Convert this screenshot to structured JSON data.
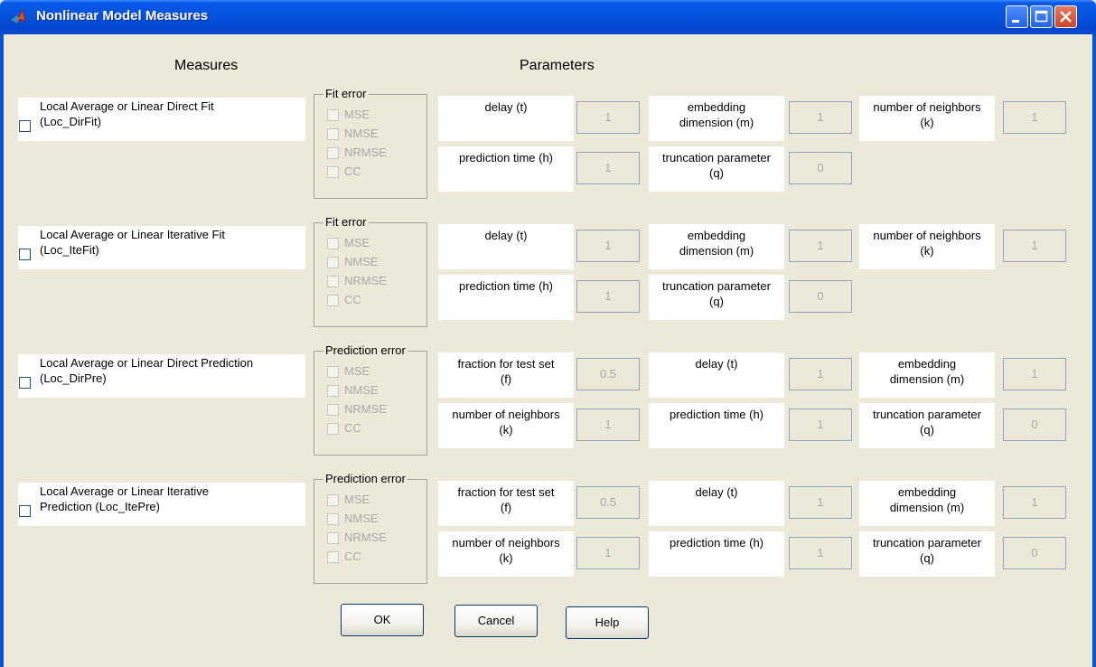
{
  "window": {
    "title": "Nonlinear Model Measures"
  },
  "headers": {
    "measures": "Measures",
    "parameters": "Parameters"
  },
  "error_items": [
    "MSE",
    "NMSE",
    "NRMSE",
    "CC"
  ],
  "rows": [
    {
      "measure_line1": "Local Average or Linear Direct Fit",
      "measure_line2": "(Loc_DirFit)",
      "group_title": "Fit error",
      "params": [
        {
          "line1": "delay (t)",
          "line2": "",
          "value": "1"
        },
        {
          "line1": "embedding",
          "line2": "dimension (m)",
          "value": "1"
        },
        {
          "line1": "number of neighbors",
          "line2": "(k)",
          "value": "1"
        },
        {
          "line1": "prediction time (h)",
          "line2": "",
          "value": "1"
        },
        {
          "line1": "truncation parameter",
          "line2": "(q)",
          "value": "0"
        }
      ]
    },
    {
      "measure_line1": "Local Average or Linear Iterative Fit",
      "measure_line2": "(Loc_IteFit)",
      "group_title": "Fit error",
      "params": [
        {
          "line1": "delay (t)",
          "line2": "",
          "value": "1"
        },
        {
          "line1": "embedding",
          "line2": "dimension (m)",
          "value": "1"
        },
        {
          "line1": "number of neighbors",
          "line2": "(k)",
          "value": "1"
        },
        {
          "line1": "prediction time (h)",
          "line2": "",
          "value": "1"
        },
        {
          "line1": "truncation parameter",
          "line2": "(q)",
          "value": "0"
        }
      ]
    },
    {
      "measure_line1": "Local Average or Linear Direct Prediction",
      "measure_line2": "(Loc_DirPre)",
      "group_title": "Prediction error",
      "params": [
        {
          "line1": "fraction for test set",
          "line2": "(f)",
          "value": "0.5"
        },
        {
          "line1": "delay (t)",
          "line2": "",
          "value": "1"
        },
        {
          "line1": "embedding",
          "line2": "dimension (m)",
          "value": "1"
        },
        {
          "line1": "number of neighbors",
          "line2": "(k)",
          "value": "1"
        },
        {
          "line1": "prediction time (h)",
          "line2": "",
          "value": "1"
        },
        {
          "line1": "truncation parameter",
          "line2": "(q)",
          "value": "0"
        }
      ]
    },
    {
      "measure_line1": "Local Average or Linear Iterative",
      "measure_line2": "Prediction (Loc_ItePre)",
      "group_title": "Prediction error",
      "params": [
        {
          "line1": "fraction for test set",
          "line2": "(f)",
          "value": "0.5"
        },
        {
          "line1": "delay (t)",
          "line2": "",
          "value": "1"
        },
        {
          "line1": "embedding",
          "line2": "dimension (m)",
          "value": "1"
        },
        {
          "line1": "number of neighbors",
          "line2": "(k)",
          "value": "1"
        },
        {
          "line1": "prediction time (h)",
          "line2": "",
          "value": "1"
        },
        {
          "line1": "truncation parameter",
          "line2": "(q)",
          "value": "0"
        }
      ]
    }
  ],
  "buttons": {
    "ok": "OK",
    "cancel": "Cancel",
    "help": "Help"
  }
}
